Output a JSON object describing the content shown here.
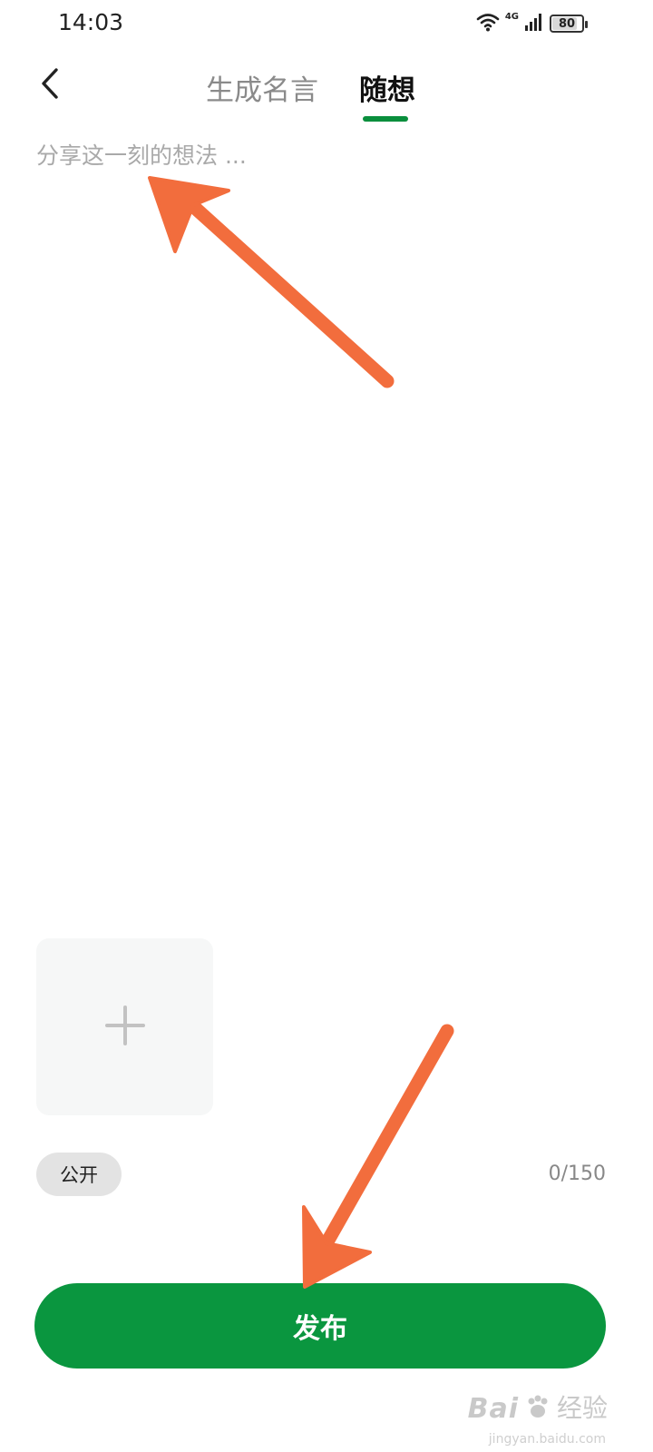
{
  "status_bar": {
    "time": "14:03",
    "network": "4G",
    "battery": "80",
    "battery_level": 0.8,
    "icons": [
      "wifi-icon",
      "cellular-signal-icon",
      "battery-icon"
    ]
  },
  "header": {
    "back_icon": "chevron-left-icon",
    "tabs": [
      {
        "label": "生成名言",
        "active": false
      },
      {
        "label": "随想",
        "active": true
      }
    ],
    "active_color": "#0a8f3d"
  },
  "editor": {
    "placeholder": "分享这一刻的想法 ..."
  },
  "attachments": {
    "add_icon": "plus-icon"
  },
  "visibility": {
    "label": "公开"
  },
  "counter": {
    "text": "0/150"
  },
  "publish": {
    "label": "发布",
    "color": "#0a963f"
  },
  "annotation_color": "#f26d3d",
  "watermark": {
    "brand": "Bai",
    "text": "经验",
    "url": "jingyan.baidu.com"
  }
}
